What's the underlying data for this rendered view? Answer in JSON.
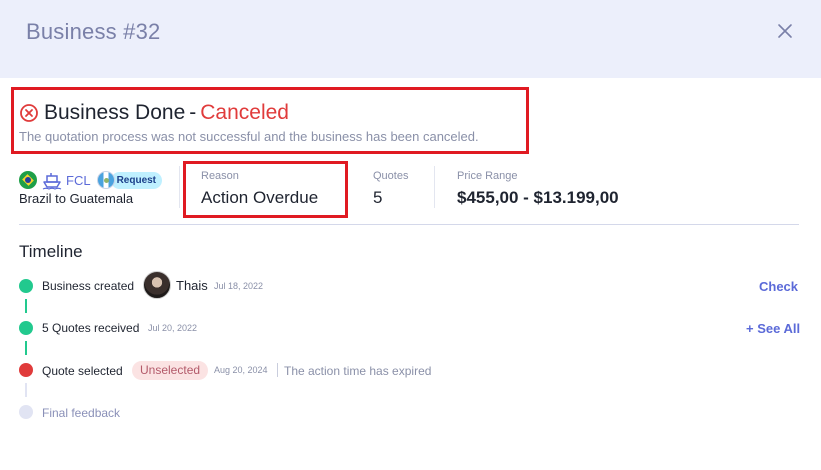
{
  "header": {
    "title": "Business #32"
  },
  "status": {
    "title": "Business Done",
    "separator": "-",
    "state": "Canceled",
    "description": "The quotation process was not successful and the business has been canceled."
  },
  "shipment": {
    "mode": "FCL",
    "request_badge": "Request",
    "route": "Brazil to Guatemala"
  },
  "summary": {
    "reason_label": "Reason",
    "reason_value": "Action Overdue",
    "quotes_label": "Quotes",
    "quotes_value": "5",
    "price_label": "Price Range",
    "price_value": "$455,00 - $13.199,00"
  },
  "timeline": {
    "title": "Timeline",
    "items": [
      {
        "label": "Business created",
        "user": "Thais",
        "date": "Jul 18, 2022",
        "action": "Check",
        "status": "done"
      },
      {
        "label": "5 Quotes received",
        "date": "Jul 20, 2022",
        "action": "+ See All",
        "status": "done"
      },
      {
        "label": "Quote selected",
        "badge": "Unselected",
        "date": "Aug 20, 2024",
        "note": "The action time has expired",
        "status": "failed"
      },
      {
        "label": "Final feedback",
        "status": "pending"
      }
    ]
  },
  "colors": {
    "accent": "#5b6ad8",
    "success": "#22c98e",
    "danger": "#e03b3b",
    "pending": "#e1e4f3",
    "highlight_border": "#e01a22"
  }
}
